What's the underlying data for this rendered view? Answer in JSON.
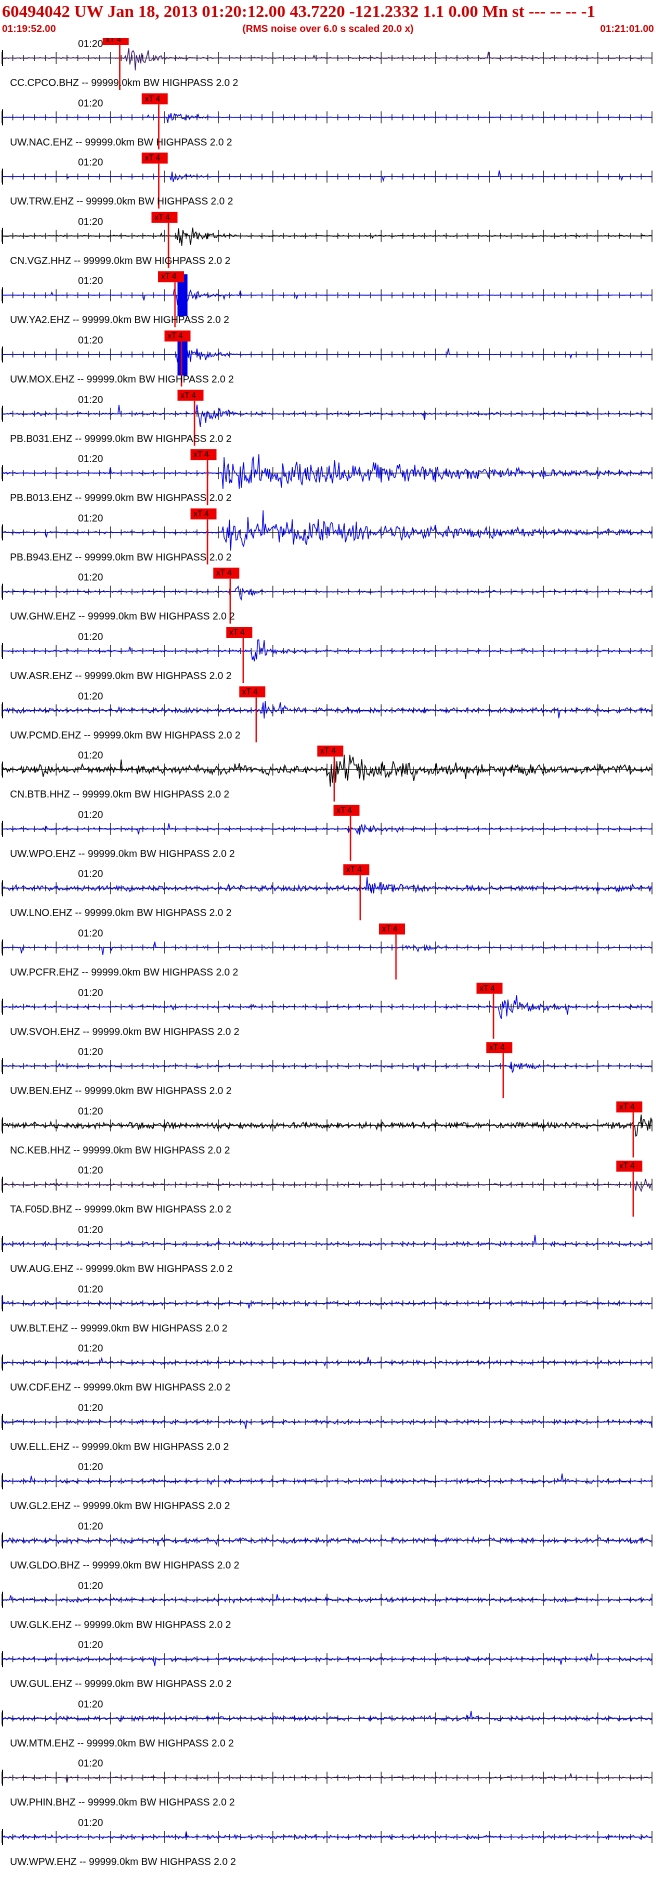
{
  "header": {
    "title": "60494042 UW Jan 18, 2013 01:20:12.00   43.7220 -121.2332  1.1 0.00 Mn st --- -- --   -1",
    "start_time": "01:19:52.00",
    "rms_note": "(RMS noise over 6.0 s scaled 20.0 x)",
    "end_time": "01:21:01.00"
  },
  "minute_label": "01:20",
  "pick_label": "xT 4",
  "colors": {
    "title": "#cc0000",
    "blue_trace": "#0000e6",
    "black_trace": "#000000",
    "purple_trace": "#3a1a6a",
    "pick": "#ee0000",
    "axis": "#000000"
  },
  "traces": [
    {
      "label": "CC.CPCO.BHZ -- 99999.0km BW  HIGHPASS  2.0  2",
      "color": "purple",
      "pick": 0.175,
      "event": 0.19,
      "amp": 0.9,
      "noise": 0.08,
      "dur": 0.03,
      "clip": false
    },
    {
      "label": "UW.NAC.EHZ -- 99999.0km BW  HIGHPASS  2.0  2",
      "color": "blue",
      "pick": 0.235,
      "event": 0.255,
      "amp": 0.7,
      "noise": 0.02,
      "dur": 0.02,
      "clip": false
    },
    {
      "label": "UW.TRW.EHZ -- 99999.0km BW  HIGHPASS  2.0  2",
      "color": "blue",
      "pick": 0.235,
      "event": 0.26,
      "amp": 0.6,
      "noise": 0.02,
      "dur": 0.02,
      "clip": false
    },
    {
      "label": "CN.VGZ.HHZ -- 99999.0km BW  HIGHPASS  2.0  2",
      "color": "black",
      "pick": 0.25,
      "event": 0.27,
      "amp": 0.9,
      "noise": 0.08,
      "dur": 0.03,
      "clip": false
    },
    {
      "label": "UW.YA2.EHZ -- 99999.0km BW  HIGHPASS  2.0  2",
      "color": "blue",
      "pick": 0.26,
      "event": 0.27,
      "amp": 1.0,
      "noise": 0.02,
      "dur": 0.025,
      "clip": true
    },
    {
      "label": "UW.MOX.EHZ -- 99999.0km BW  HIGHPASS  2.0  2",
      "color": "blue",
      "pick": 0.27,
      "event": 0.27,
      "amp": 1.0,
      "noise": 0.02,
      "dur": 0.03,
      "clip": true
    },
    {
      "label": "PB.B031.EHZ -- 99999.0km BW  HIGHPASS  2.0  2",
      "color": "blue",
      "pick": 0.29,
      "event": 0.3,
      "amp": 0.7,
      "noise": 0.12,
      "dur": 0.03,
      "clip": false
    },
    {
      "label": "PB.B013.EHZ -- 99999.0km BW  HIGHPASS  2.0  2",
      "color": "blue",
      "pick": 0.31,
      "event": 0.34,
      "amp": 1.0,
      "noise": 0.1,
      "dur": 0.3,
      "clip": false
    },
    {
      "label": "PB.B943.EHZ -- 99999.0km BW  HIGHPASS  2.0  2",
      "color": "blue",
      "pick": 0.31,
      "event": 0.34,
      "amp": 1.0,
      "noise": 0.1,
      "dur": 0.3,
      "clip": false
    },
    {
      "label": "UW.GHW.EHZ -- 99999.0km BW  HIGHPASS  2.0  2",
      "color": "blue",
      "pick": 0.345,
      "event": 0.36,
      "amp": 0.5,
      "noise": 0.1,
      "dur": 0.02,
      "clip": false
    },
    {
      "label": "UW.ASR.EHZ -- 99999.0km BW  HIGHPASS  2.0  2",
      "color": "blue",
      "pick": 0.365,
      "event": 0.385,
      "amp": 1.0,
      "noise": 0.12,
      "dur": 0.025,
      "clip": false
    },
    {
      "label": "UW.PCMD.EHZ -- 99999.0km BW  HIGHPASS  2.0  2",
      "color": "blue",
      "pick": 0.385,
      "event": 0.4,
      "amp": 0.8,
      "noise": 0.25,
      "dur": 0.03,
      "clip": false
    },
    {
      "label": "CN.BTB.HHZ -- 99999.0km BW  HIGHPASS  2.0  2",
      "color": "black",
      "pick": 0.505,
      "event": 0.5,
      "amp": 1.0,
      "noise": 0.45,
      "dur": 0.15,
      "clip": false
    },
    {
      "label": "UW.WPO.EHZ -- 99999.0km BW  HIGHPASS  2.0  2",
      "color": "blue",
      "pick": 0.53,
      "event": 0.545,
      "amp": 0.5,
      "noise": 0.12,
      "dur": 0.03,
      "clip": false
    },
    {
      "label": "UW.LNO.EHZ -- 99999.0km BW  HIGHPASS  2.0  2",
      "color": "blue",
      "pick": 0.545,
      "event": 0.56,
      "amp": 0.7,
      "noise": 0.3,
      "dur": 0.04,
      "clip": false
    },
    {
      "label": "UW.PCFR.EHZ -- 99999.0km BW  HIGHPASS  2.0  2",
      "color": "blue",
      "pick": 0.6,
      "event": 0.62,
      "amp": 0.3,
      "noise": 0.08,
      "dur": 0.04,
      "clip": false
    },
    {
      "label": "UW.SVOH.EHZ -- 99999.0km BW  HIGHPASS  2.0  2",
      "color": "blue",
      "pick": 0.75,
      "event": 0.765,
      "amp": 0.8,
      "noise": 0.12,
      "dur": 0.05,
      "clip": false
    },
    {
      "label": "UW.BEN.EHZ -- 99999.0km BW  HIGHPASS  2.0  2",
      "color": "blue",
      "pick": 0.765,
      "event": 0.78,
      "amp": 0.3,
      "noise": 0.12,
      "dur": 0.03,
      "clip": false
    },
    {
      "label": "NC.KEB.HHZ -- 99999.0km BW  HIGHPASS  2.0  2",
      "color": "black",
      "pick": 0.965,
      "event": 0.975,
      "amp": 0.8,
      "noise": 0.35,
      "dur": 0.03,
      "clip": false
    },
    {
      "label": "TA.F05D.BHZ -- 99999.0km BW  HIGHPASS  2.0  2",
      "color": "purple",
      "pick": 0.965,
      "event": 0.975,
      "amp": 0.5,
      "noise": 0.12,
      "dur": 0.02,
      "clip": false
    },
    {
      "label": "UW.AUG.EHZ -- 99999.0km BW  HIGHPASS  2.0  2",
      "color": "blue",
      "noise": 0.18
    },
    {
      "label": "UW.BLT.EHZ -- 99999.0km BW  HIGHPASS  2.0  2",
      "color": "blue",
      "noise": 0.18
    },
    {
      "label": "UW.CDF.EHZ -- 99999.0km BW  HIGHPASS  2.0  2",
      "color": "blue",
      "noise": 0.18
    },
    {
      "label": "UW.ELL.EHZ -- 99999.0km BW  HIGHPASS  2.0  2",
      "color": "blue",
      "noise": 0.18
    },
    {
      "label": "UW.GL2.EHZ -- 99999.0km BW  HIGHPASS  2.0  2",
      "color": "blue",
      "noise": 0.18
    },
    {
      "label": "UW.GLDO.BHZ -- 99999.0km BW  HIGHPASS  2.0  2",
      "color": "blue",
      "noise": 0.28
    },
    {
      "label": "UW.GLK.EHZ -- 99999.0km BW  HIGHPASS  2.0  2",
      "color": "blue",
      "noise": 0.2
    },
    {
      "label": "UW.GUL.EHZ -- 99999.0km BW  HIGHPASS  2.0  2",
      "color": "blue",
      "noise": 0.18
    },
    {
      "label": "UW.MTM.EHZ -- 99999.0km BW  HIGHPASS  2.0  2",
      "color": "blue",
      "noise": 0.22
    },
    {
      "label": "UW.PHIN.BHZ -- 99999.0km BW  HIGHPASS  2.0  2",
      "color": "purple",
      "noise": 0.1
    },
    {
      "label": "UW.WPW.EHZ -- 99999.0km BW  HIGHPASS  2.0  2",
      "color": "blue",
      "noise": 0.18
    }
  ]
}
